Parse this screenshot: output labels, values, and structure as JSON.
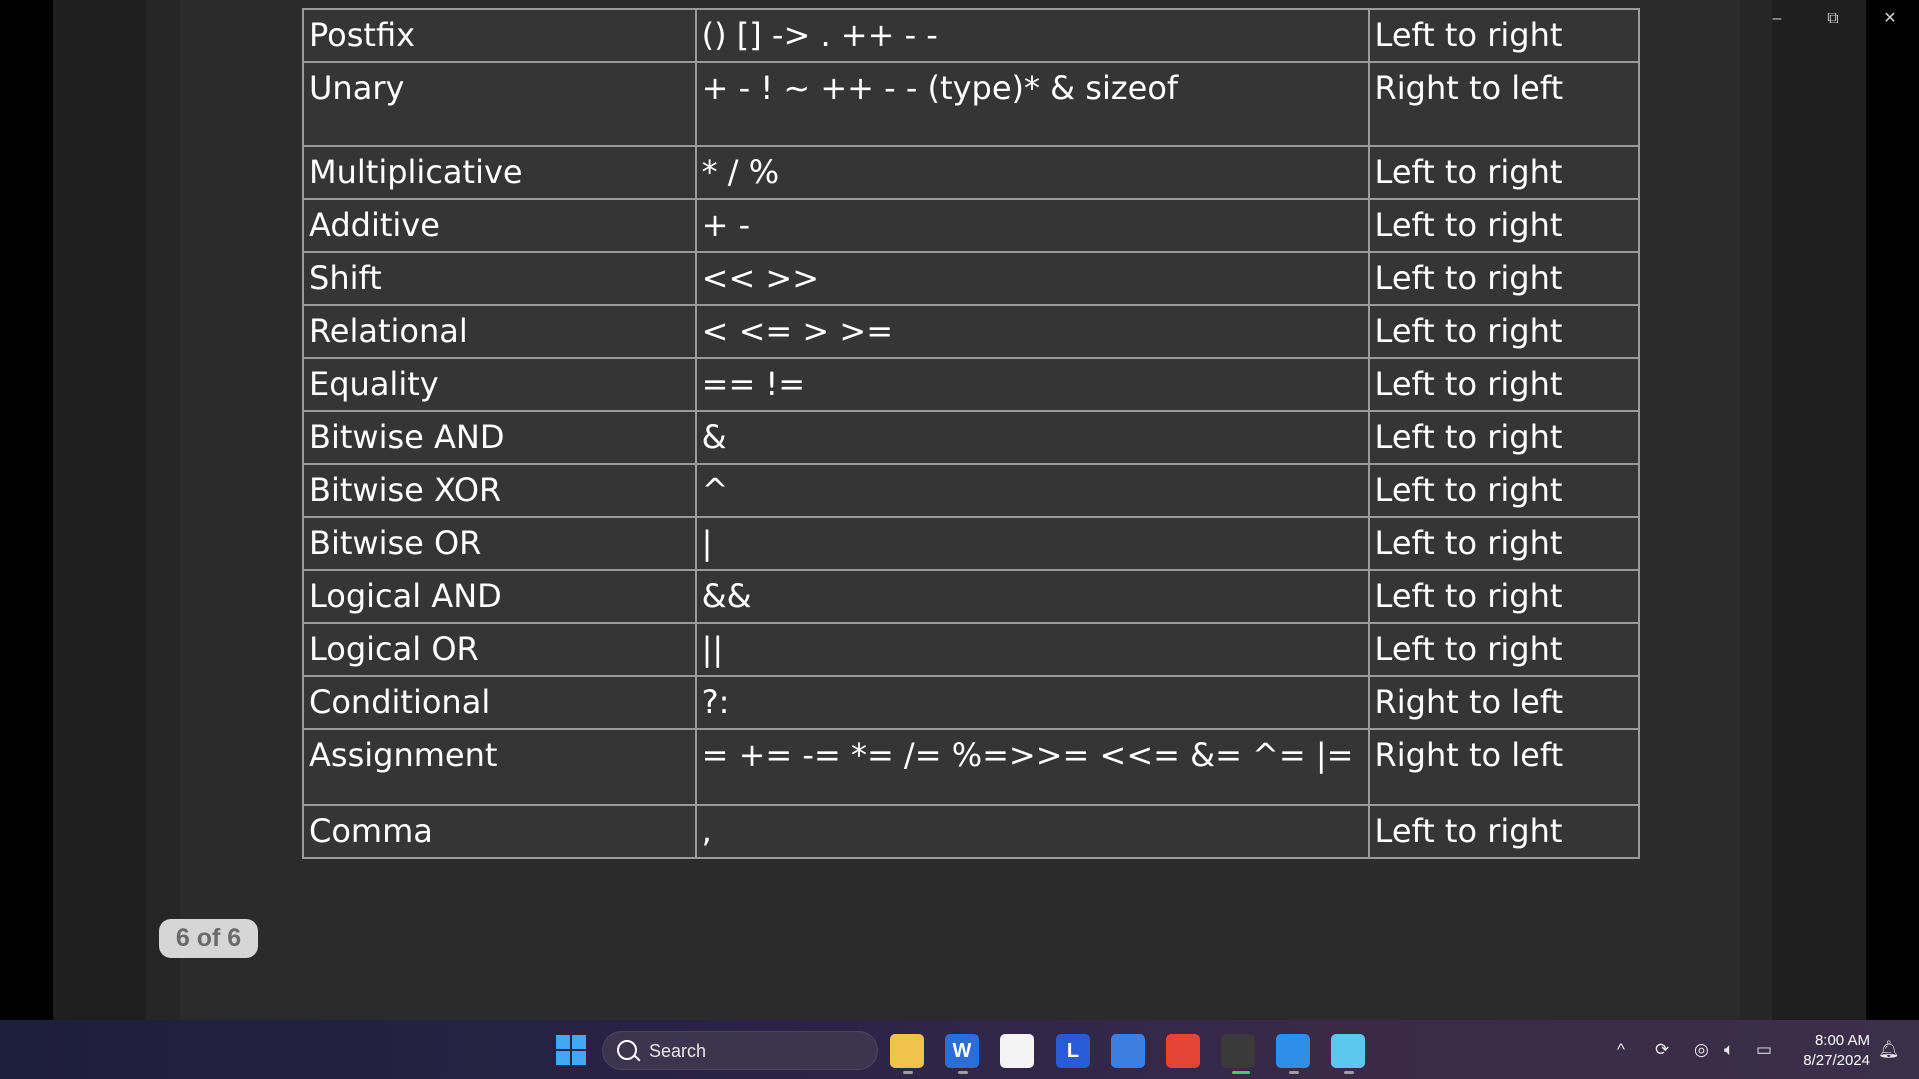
{
  "table": {
    "rows": [
      {
        "category": "Postfix",
        "operators": "() [] -> . ++ - -",
        "associativity": "Left to right"
      },
      {
        "category": "Unary",
        "operators": "+ - ! ~ ++ - - (type)* & sizeof",
        "associativity": "Right to left"
      },
      {
        "category": "Multiplicative",
        "operators": "* / %",
        "associativity": "Left to right"
      },
      {
        "category": "Additive",
        "operators": "+ -",
        "associativity": "Left to right"
      },
      {
        "category": "Shift",
        "operators": "<< >>",
        "associativity": "Left to right"
      },
      {
        "category": "Relational",
        "operators": "< <= > >=",
        "associativity": "Left to right"
      },
      {
        "category": "Equality",
        "operators": "== !=",
        "associativity": "Left to right"
      },
      {
        "category": "Bitwise AND",
        "operators": "&",
        "associativity": "Left to right"
      },
      {
        "category": "Bitwise XOR",
        "operators": "^",
        "associativity": "Left to right"
      },
      {
        "category": "Bitwise OR",
        "operators": "|",
        "associativity": "Left to right"
      },
      {
        "category": "Logical AND",
        "operators": "&&",
        "associativity": "Left to right"
      },
      {
        "category": "Logical OR",
        "operators": "||",
        "associativity": "Left to right"
      },
      {
        "category": "Conditional",
        "operators": "?:",
        "associativity": "Right to left"
      },
      {
        "category": "Assignment",
        "operators": "= += -= *= /= %=>>= <<= &= ^= |=",
        "associativity": "Right to left"
      },
      {
        "category": "Comma",
        "operators": ",",
        "associativity": "Left to right"
      }
    ]
  },
  "viewer": {
    "page_indicator": "6 of 6",
    "minimize_glyph": "–",
    "restore_glyph": "⧉",
    "close_glyph": "✕"
  },
  "taskbar": {
    "search_placeholder": "Search",
    "apps": [
      {
        "name": "file-explorer-icon",
        "color": "#f2c14e"
      },
      {
        "name": "word-icon",
        "color": "#2b6fd6",
        "label": "W"
      },
      {
        "name": "store-icon",
        "color": "#f4f4f4"
      },
      {
        "name": "l-app-icon",
        "color": "#2a5bd7",
        "label": "L"
      },
      {
        "name": "draw-app-icon",
        "color": "#3c7fe0"
      },
      {
        "name": "chrome-icon",
        "color": "#e54335"
      },
      {
        "name": "media-player-icon",
        "color": "#3a3a3a"
      },
      {
        "name": "vscode-icon",
        "color": "#2f8ee8"
      },
      {
        "name": "notepad-icon",
        "color": "#5cc8f0"
      }
    ],
    "tray": {
      "chevron": "^",
      "time": "8:00 AM",
      "date": "8/27/2024"
    }
  }
}
